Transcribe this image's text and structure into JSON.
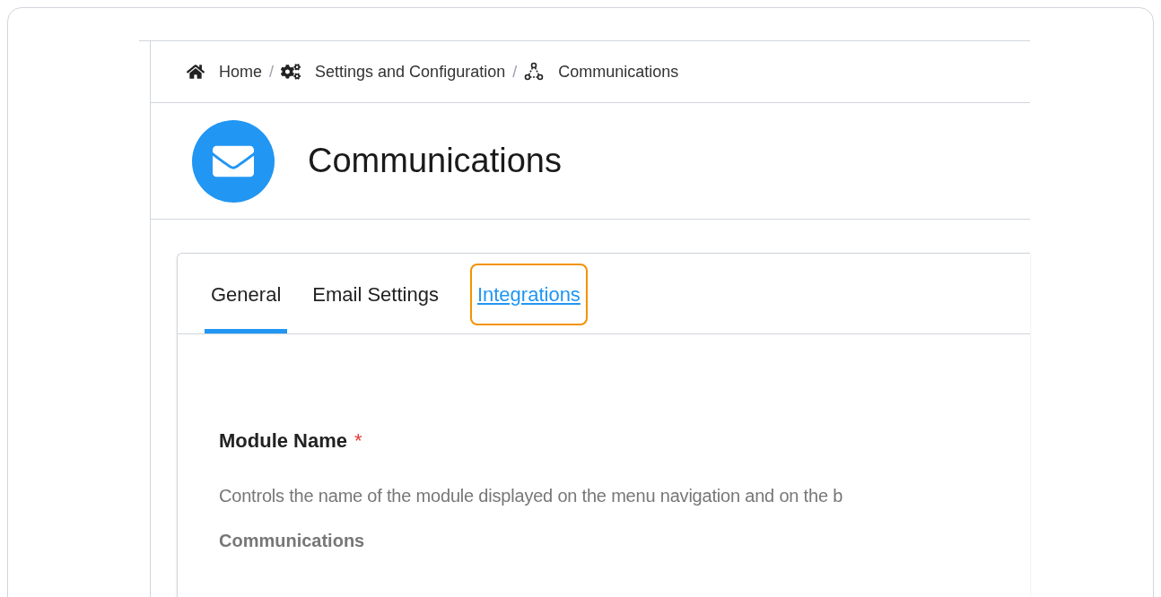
{
  "breadcrumb": [
    {
      "kind": "home",
      "label": "Home"
    },
    {
      "kind": "settings",
      "label": "Settings and Configuration"
    },
    {
      "kind": "module",
      "label": "Communications"
    }
  ],
  "breadcrumb_separator": "/",
  "page_title": "Communications",
  "tabs": [
    {
      "label": "General",
      "selected": true,
      "highlighted": false
    },
    {
      "label": "Email Settings",
      "selected": false,
      "highlighted": false
    },
    {
      "label": "Integrations",
      "selected": false,
      "highlighted": true
    }
  ],
  "field": {
    "label": "Module Name",
    "required_mark": "*",
    "description": "Controls the name of the module displayed on the menu navigation and on the b",
    "value": "Communications"
  }
}
